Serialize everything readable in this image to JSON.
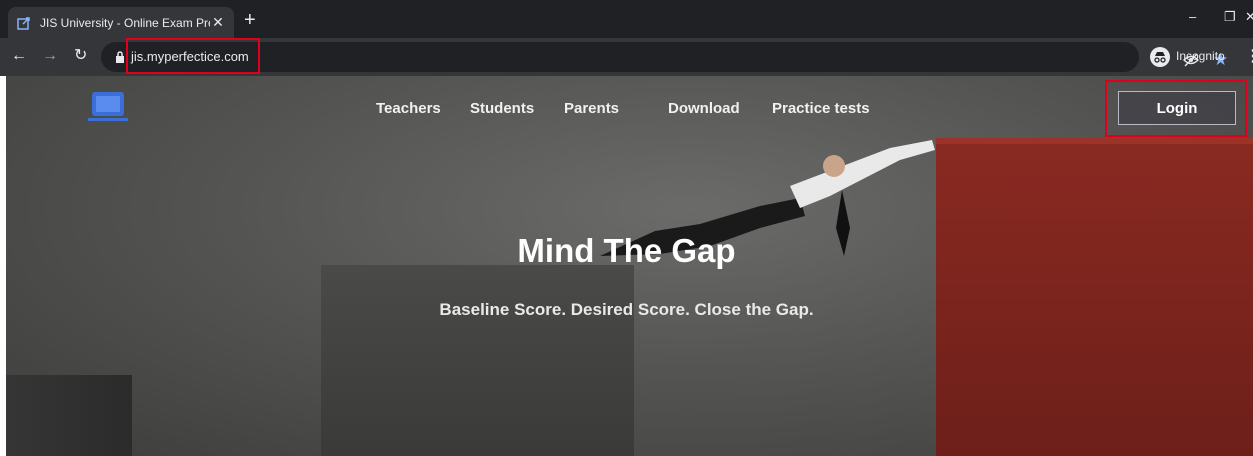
{
  "browser": {
    "tab_title": "JIS University - Online Exam Prep",
    "tab_close": "✕",
    "new_tab": "+",
    "url": "jis.myperfectice.com",
    "incognito_label": "Incognito",
    "icons": [
      "favicon-icon",
      "back-icon",
      "forward-icon",
      "reload-icon",
      "lock-icon",
      "eye-off-icon",
      "star-icon",
      "incognito-icon",
      "menu-icon"
    ]
  },
  "page": {
    "nav": {
      "teachers": "Teachers",
      "students": "Students",
      "parents": "Parents",
      "download": "Download",
      "practice": "Practice tests"
    },
    "login_label": "Login",
    "hero_title": "Mind The Gap",
    "hero_subtitle": "Baseline Score. Desired Score. Close the Gap.",
    "highlight_color": "#e0001b"
  }
}
